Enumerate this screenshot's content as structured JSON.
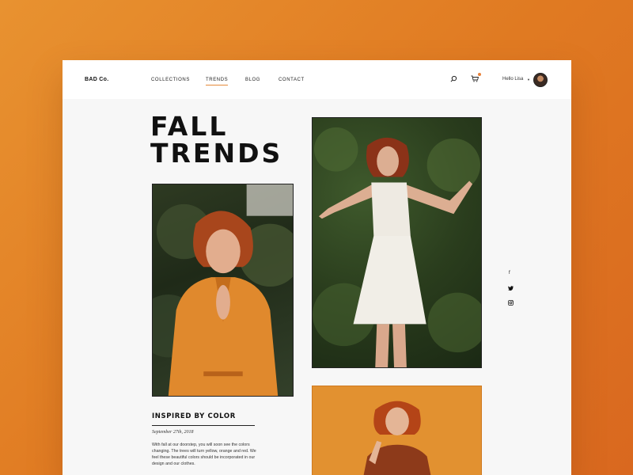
{
  "brand": "BAD Co.",
  "nav": {
    "items": [
      {
        "label": "COLLECTIONS",
        "active": false
      },
      {
        "label": "TRENDS",
        "active": true
      },
      {
        "label": "BLOG",
        "active": false
      },
      {
        "label": "CONTACT",
        "active": false
      }
    ],
    "greeting": "Hello Lisa",
    "cart_has_items": true
  },
  "hero": {
    "line1": "FALL",
    "line2": "TRENDS"
  },
  "article": {
    "title": "INSPIRED BY COLOR",
    "date": "September 27th, 2018",
    "body": "With fall at our doorstep, you will soon see the colors changing. The trees will turn yellow, orange and red. We feel these beautiful colors should be incorporated in our design and our clothes."
  },
  "social": [
    "facebook-icon",
    "twitter-icon",
    "instagram-icon"
  ],
  "colors": {
    "accent": "#e8823a",
    "background": "#e08a2c",
    "page": "#f7f7f7"
  }
}
